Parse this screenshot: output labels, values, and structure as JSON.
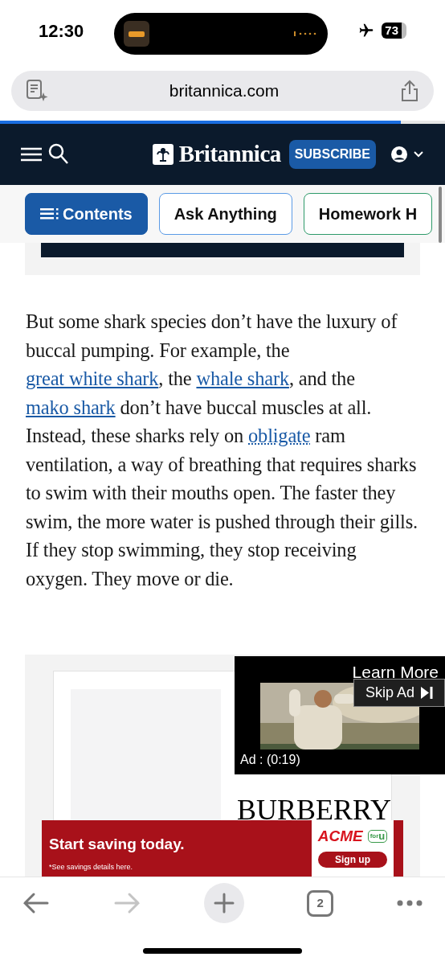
{
  "status_bar": {
    "time": "12:30",
    "battery": "73",
    "airplane_mode": true
  },
  "address_bar": {
    "url": "britannica.com",
    "load_progress": {
      "level": 0.9
    }
  },
  "site_header": {
    "logo": "Britannica",
    "subscribe": "SUBSCRIBE"
  },
  "chips": [
    {
      "label": "Contents",
      "selected": true,
      "color": "#1a5aa6"
    },
    {
      "label": "Ask Anything",
      "selected": false,
      "color": "#5b9be6"
    },
    {
      "label": "Homework H",
      "selected": false,
      "color": "#2e9a6a"
    }
  ],
  "article": {
    "segments": [
      {
        "kind": "text",
        "text": "But some shark species don’t have the luxury of buccal pumping. For example, the "
      },
      {
        "kind": "link",
        "text": "great white shark"
      },
      {
        "kind": "text",
        "text": ", the "
      },
      {
        "kind": "link",
        "text": "whale shark"
      },
      {
        "kind": "text",
        "text": ", and the "
      },
      {
        "kind": "link",
        "text": "mako shark"
      },
      {
        "kind": "text",
        "text": " don’t have buccal muscles at all. Instead, these sharks rely on "
      },
      {
        "kind": "definition",
        "text": "obligate"
      },
      {
        "kind": "text",
        "text": " ram ventilation, a way of breathing that requires sharks to swim with their mouths open. The faster they swim, the more water is pushed through their gills. If they stop swimming, they stop receiving oxygen. They move or die."
      }
    ]
  },
  "video_ad": {
    "learn_more": "Learn More",
    "skip": "Skip Ad",
    "timer": "Ad : (0:19)"
  },
  "display_ad": {
    "brand": "BURBERRY"
  },
  "banner_ad": {
    "headline": "Start saving today.",
    "note": "*See savings details here.",
    "brand": "ACME",
    "badge_small": "for",
    "badge": "u",
    "button": "Sign up"
  },
  "toolbar": {
    "tab_count": "2",
    "forward_disabled": true
  }
}
